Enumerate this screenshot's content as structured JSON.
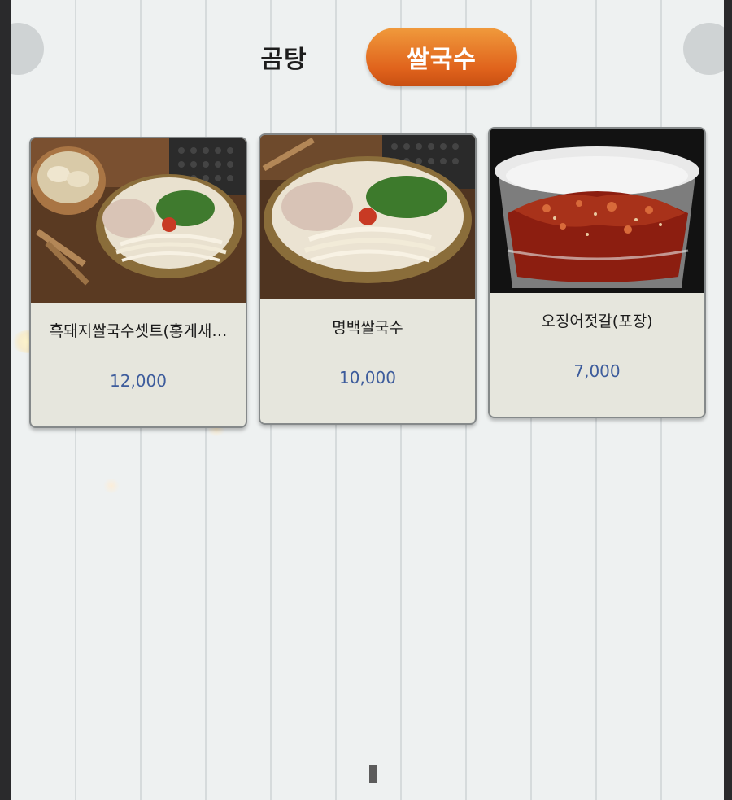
{
  "tabs": [
    {
      "label": "곰탕",
      "active": false
    },
    {
      "label": "쌀국수",
      "active": true
    }
  ],
  "colors": {
    "active_tab": "#e36a22",
    "price": "#3d5c9c",
    "card_bg": "#e6e6dd"
  },
  "menu_items": [
    {
      "name": "흑돼지쌀국수셋트(홍게새…",
      "price": "12,000",
      "image": "noodle-soup-with-dumplings-photo"
    },
    {
      "name": "명백쌀국수",
      "price": "10,000",
      "image": "noodle-soup-photo"
    },
    {
      "name": "오징어젓갈(포장)",
      "price": "7,000",
      "image": "squid-jeotgal-container-photo"
    }
  ],
  "icons": {
    "prev": "chevron-left-icon",
    "next": "chevron-right-icon",
    "pager": "page-indicator"
  }
}
